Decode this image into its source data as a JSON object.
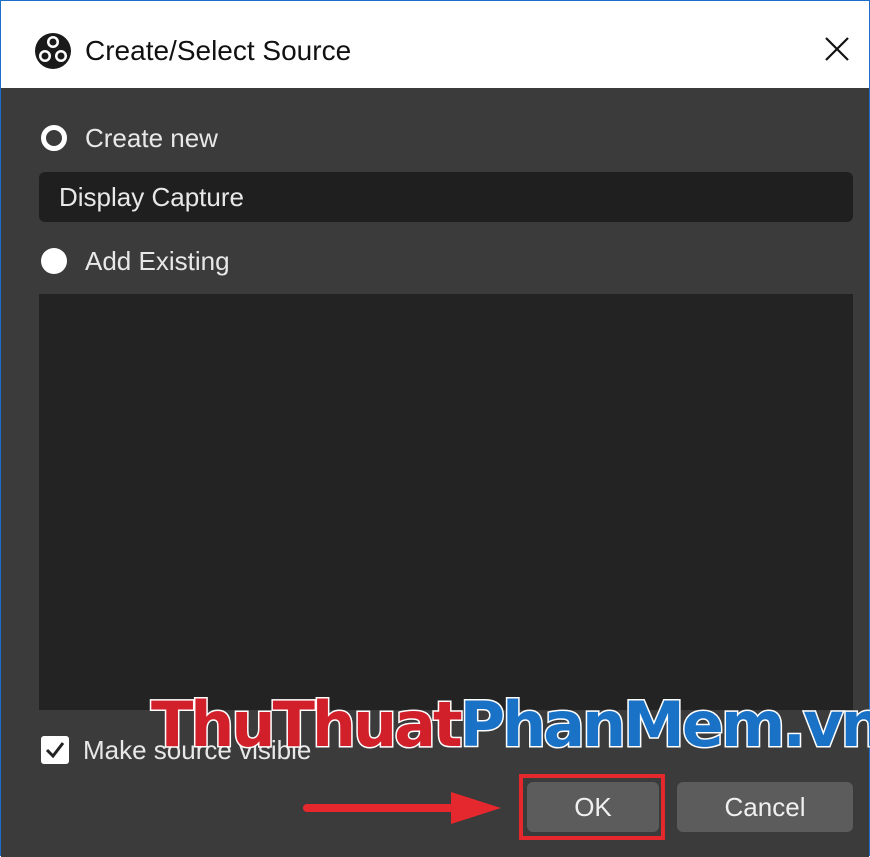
{
  "window": {
    "title": "Create/Select Source",
    "app_icon": "obs-logo-icon",
    "close_icon": "close-icon"
  },
  "options": {
    "create_new_label": "Create new",
    "create_new_selected": true,
    "name_value": "Display Capture",
    "add_existing_label": "Add Existing",
    "add_existing_selected": false,
    "existing_sources": []
  },
  "visibility": {
    "label": "Make source visible",
    "checked": true
  },
  "buttons": {
    "ok_label": "OK",
    "cancel_label": "Cancel"
  },
  "watermark": {
    "part1": "ThuThuat",
    "part2": "PhanMem",
    "part3": ".vn"
  },
  "annotation": {
    "highlight_color": "#e5282e",
    "arrow_icon": "arrow-right-icon"
  }
}
